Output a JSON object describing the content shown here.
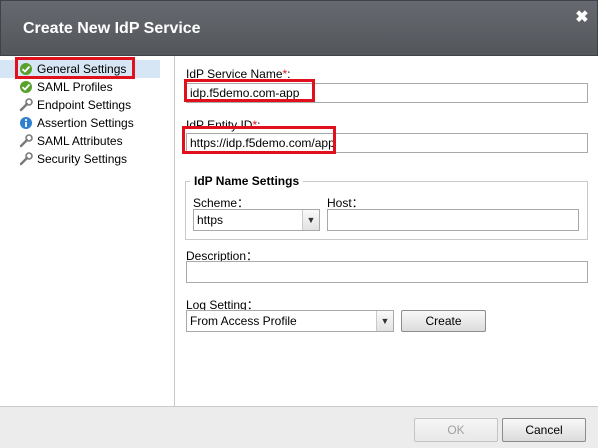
{
  "dialog": {
    "title": "Create New IdP Service",
    "close_label": "✖"
  },
  "sidebar": {
    "items": [
      {
        "label": "General Settings",
        "icon": "check-circle-icon"
      },
      {
        "label": "SAML Profiles",
        "icon": "check-circle-icon"
      },
      {
        "label": "Endpoint Settings",
        "icon": "wrench-icon"
      },
      {
        "label": "Assertion Settings",
        "icon": "info-icon"
      },
      {
        "label": "SAML Attributes",
        "icon": "wrench-icon"
      },
      {
        "label": "Security Settings",
        "icon": "wrench-icon"
      }
    ],
    "selected_index": 0
  },
  "form": {
    "service_name": {
      "label": "IdP Service Name",
      "required_mark": "*",
      "suffix": ":",
      "value": "idp.f5demo.com-app"
    },
    "entity_id": {
      "label": "IdP Entity ID",
      "required_mark": "*",
      "suffix": ":",
      "value": "https://idp.f5demo.com/app"
    },
    "name_settings": {
      "legend": "IdP Name Settings",
      "scheme_label": "Scheme：",
      "scheme_value": "https",
      "host_label": "Host：",
      "host_value": ""
    },
    "description": {
      "label": "Description：",
      "value": ""
    },
    "log_setting": {
      "label": "Log Setting：",
      "value": "From Access Profile",
      "create_label": "Create"
    }
  },
  "footer": {
    "ok_label": "OK",
    "cancel_label": "Cancel"
  },
  "colors": {
    "required": "#e0101c",
    "highlight": "#e0101c",
    "selected_bg": "#d6e6f5",
    "titlebar": "#5d6166"
  }
}
